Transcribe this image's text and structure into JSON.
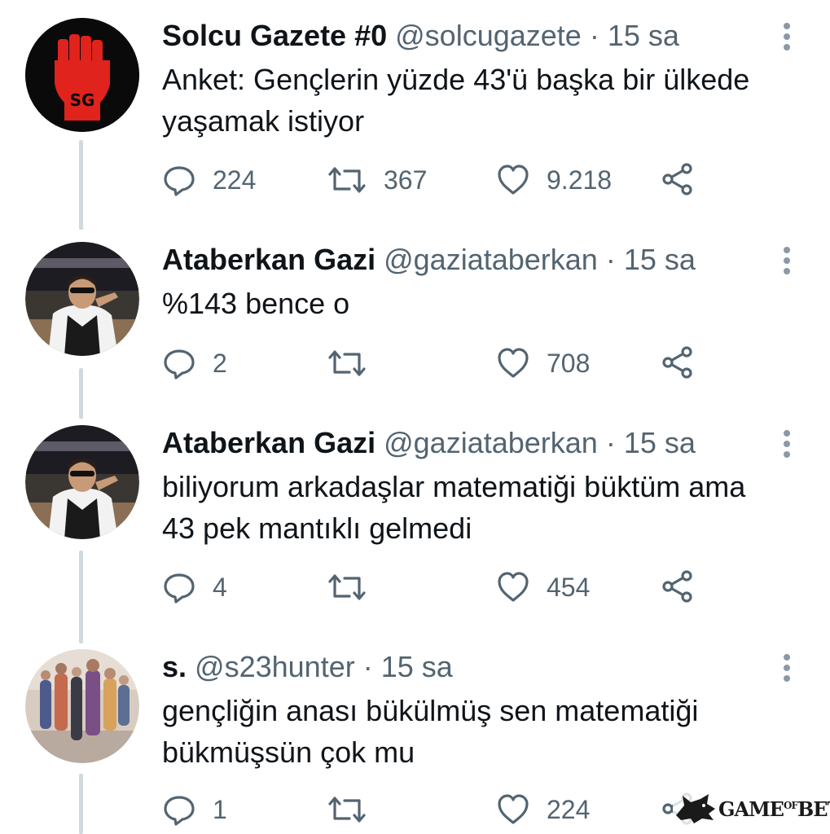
{
  "tweets": [
    {
      "name": "Solcu Gazete #0",
      "handle": "@solcugazete",
      "dot": "·",
      "time": "15 sa",
      "avatar_icon": "raised-fist-logo",
      "avatar_text": "SG",
      "lines": [
        "Anket: Gençlerin yüzde 43'ü başka bir ülkede",
        "yaşamak istiyor"
      ],
      "replies": "224",
      "retweets": "367",
      "likes": "9.218"
    },
    {
      "name": "Ataberkan Gazi",
      "handle": "@gaziataberkan",
      "dot": "·",
      "time": "15 sa",
      "avatar_icon": "profile-photo",
      "lines": [
        "%143 bence o"
      ],
      "replies": "2",
      "retweets": "",
      "likes": "708"
    },
    {
      "name": "Ataberkan Gazi",
      "handle": "@gaziataberkan",
      "dot": "·",
      "time": "15 sa",
      "avatar_icon": "profile-photo",
      "lines": [
        "biliyorum arkadaşlar matematiği büktüm ama",
        "43 pek mantıklı gelmedi"
      ],
      "replies": "4",
      "retweets": "",
      "likes": "454"
    },
    {
      "name": "s.",
      "handle": "@s23hunter",
      "dot": "·",
      "time": "15 sa",
      "avatar_icon": "profile-photo",
      "lines": [
        "gençliğin anası bükülmüş sen matematiği",
        "bükmüşsün çok mu"
      ],
      "replies": "1",
      "retweets": "",
      "likes": "224"
    }
  ],
  "watermark": {
    "main": "GAME",
    "mid": "OF",
    "end": "BET"
  },
  "colors": {
    "text": "#0f1419",
    "secondary": "#536471",
    "thread_line": "#cfd9de",
    "logo_red": "#e0231c"
  }
}
